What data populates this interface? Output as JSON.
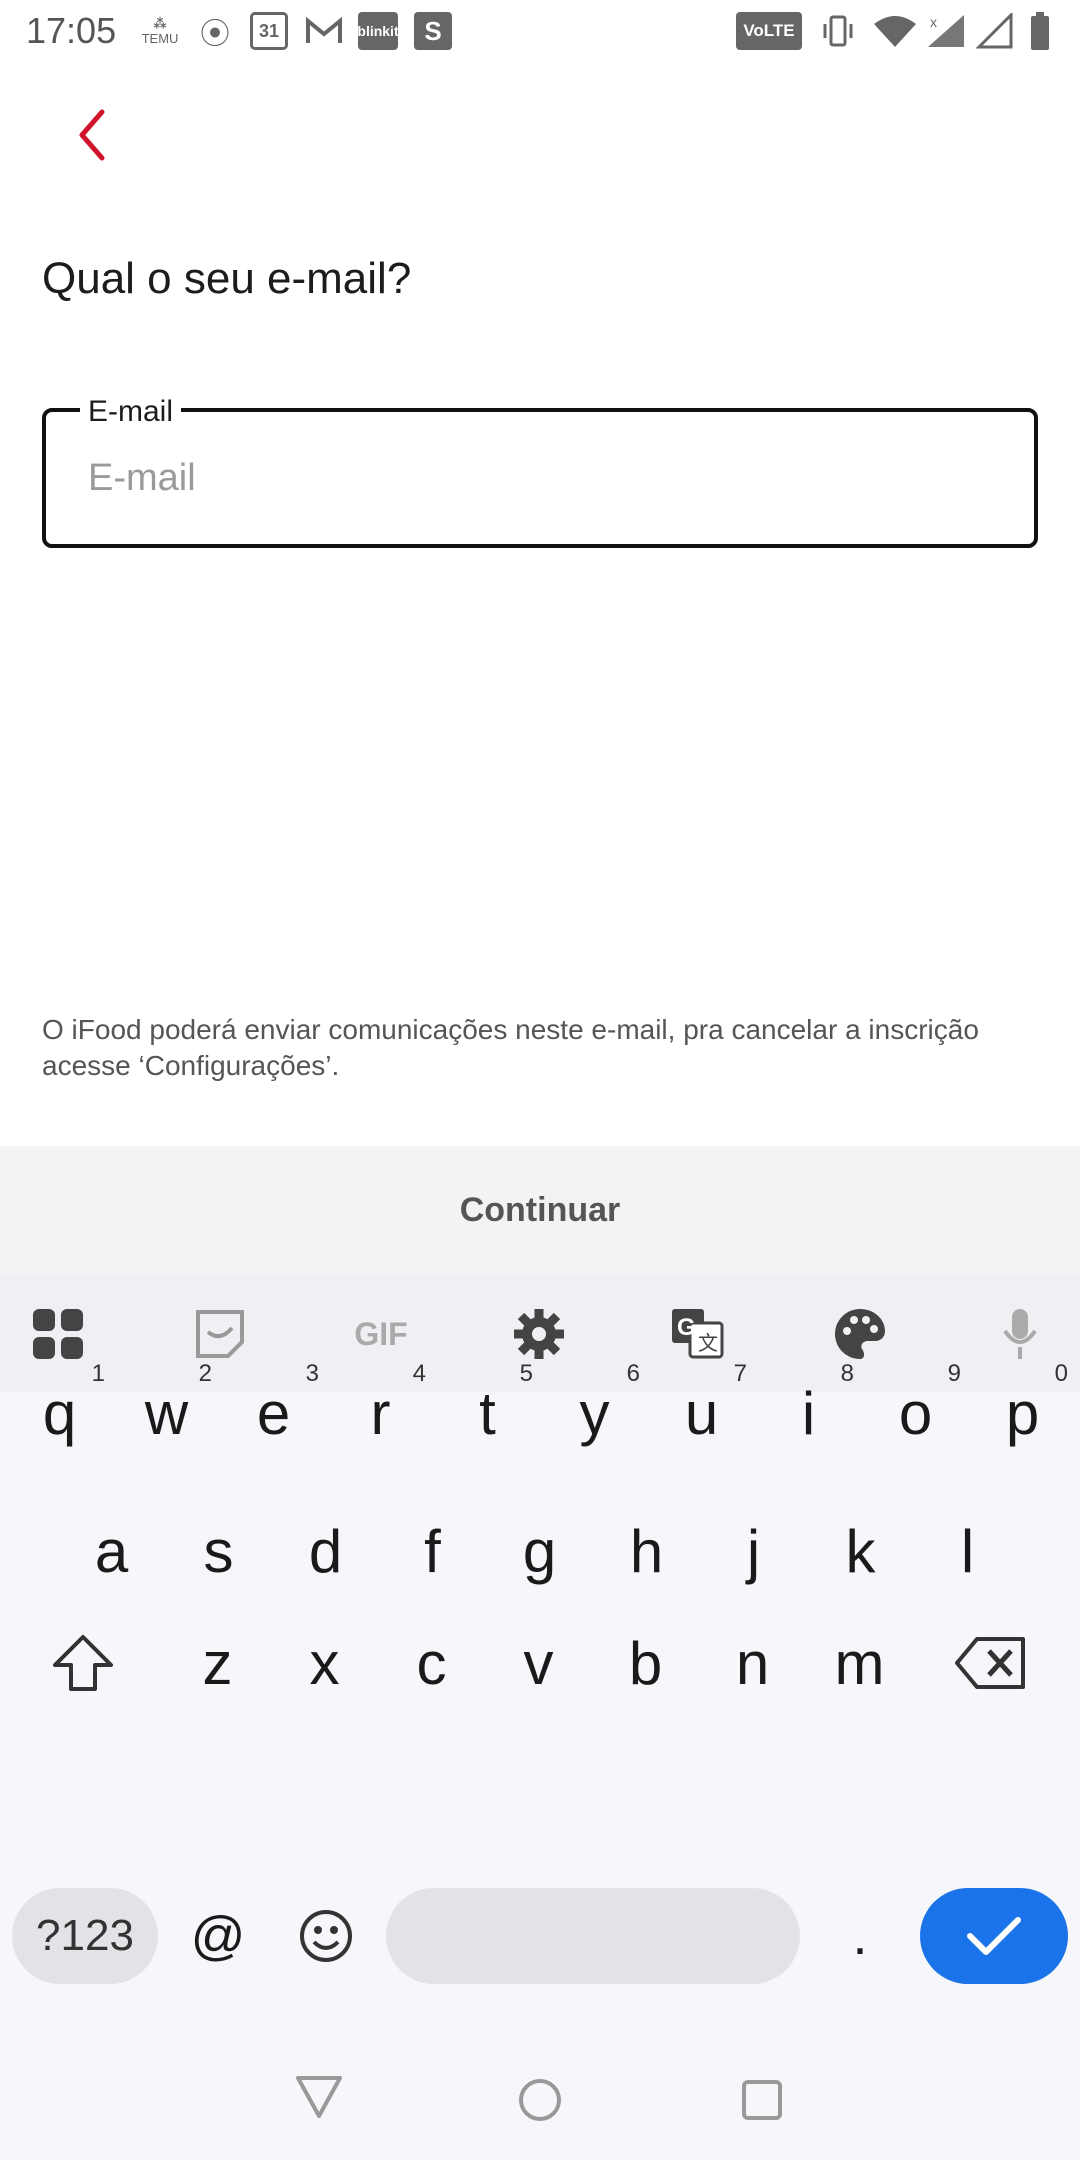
{
  "status_bar": {
    "time": "17:05",
    "temu_label": "TEMU",
    "calendar_day": "31",
    "blinkit_label": "blinkit",
    "s_label": "S",
    "volte_label": "VoLTE"
  },
  "page": {
    "title": "Qual o seu e-mail?",
    "email_label": "E-mail",
    "email_placeholder": "E-mail",
    "email_value": "",
    "note": "O iFood poderá enviar comunicações neste e-mail, pra cancelar a inscrição acesse ‘Configurações’.",
    "continue_label": "Continuar"
  },
  "keyboard": {
    "row1": [
      {
        "k": "q",
        "h": "1"
      },
      {
        "k": "w",
        "h": "2"
      },
      {
        "k": "e",
        "h": "3"
      },
      {
        "k": "r",
        "h": "4"
      },
      {
        "k": "t",
        "h": "5"
      },
      {
        "k": "y",
        "h": "6"
      },
      {
        "k": "u",
        "h": "7"
      },
      {
        "k": "i",
        "h": "8"
      },
      {
        "k": "o",
        "h": "9"
      },
      {
        "k": "p",
        "h": "0"
      }
    ],
    "row2": [
      "a",
      "s",
      "d",
      "f",
      "g",
      "h",
      "j",
      "k",
      "l"
    ],
    "row3": [
      "z",
      "x",
      "c",
      "v",
      "b",
      "n",
      "m"
    ],
    "symbols_label": "?123",
    "at_label": "@",
    "period_label": ".",
    "gif_label": "GIF"
  },
  "colors": {
    "accent_red": "#d0132b",
    "keyboard_enter_blue": "#1a73e8"
  }
}
